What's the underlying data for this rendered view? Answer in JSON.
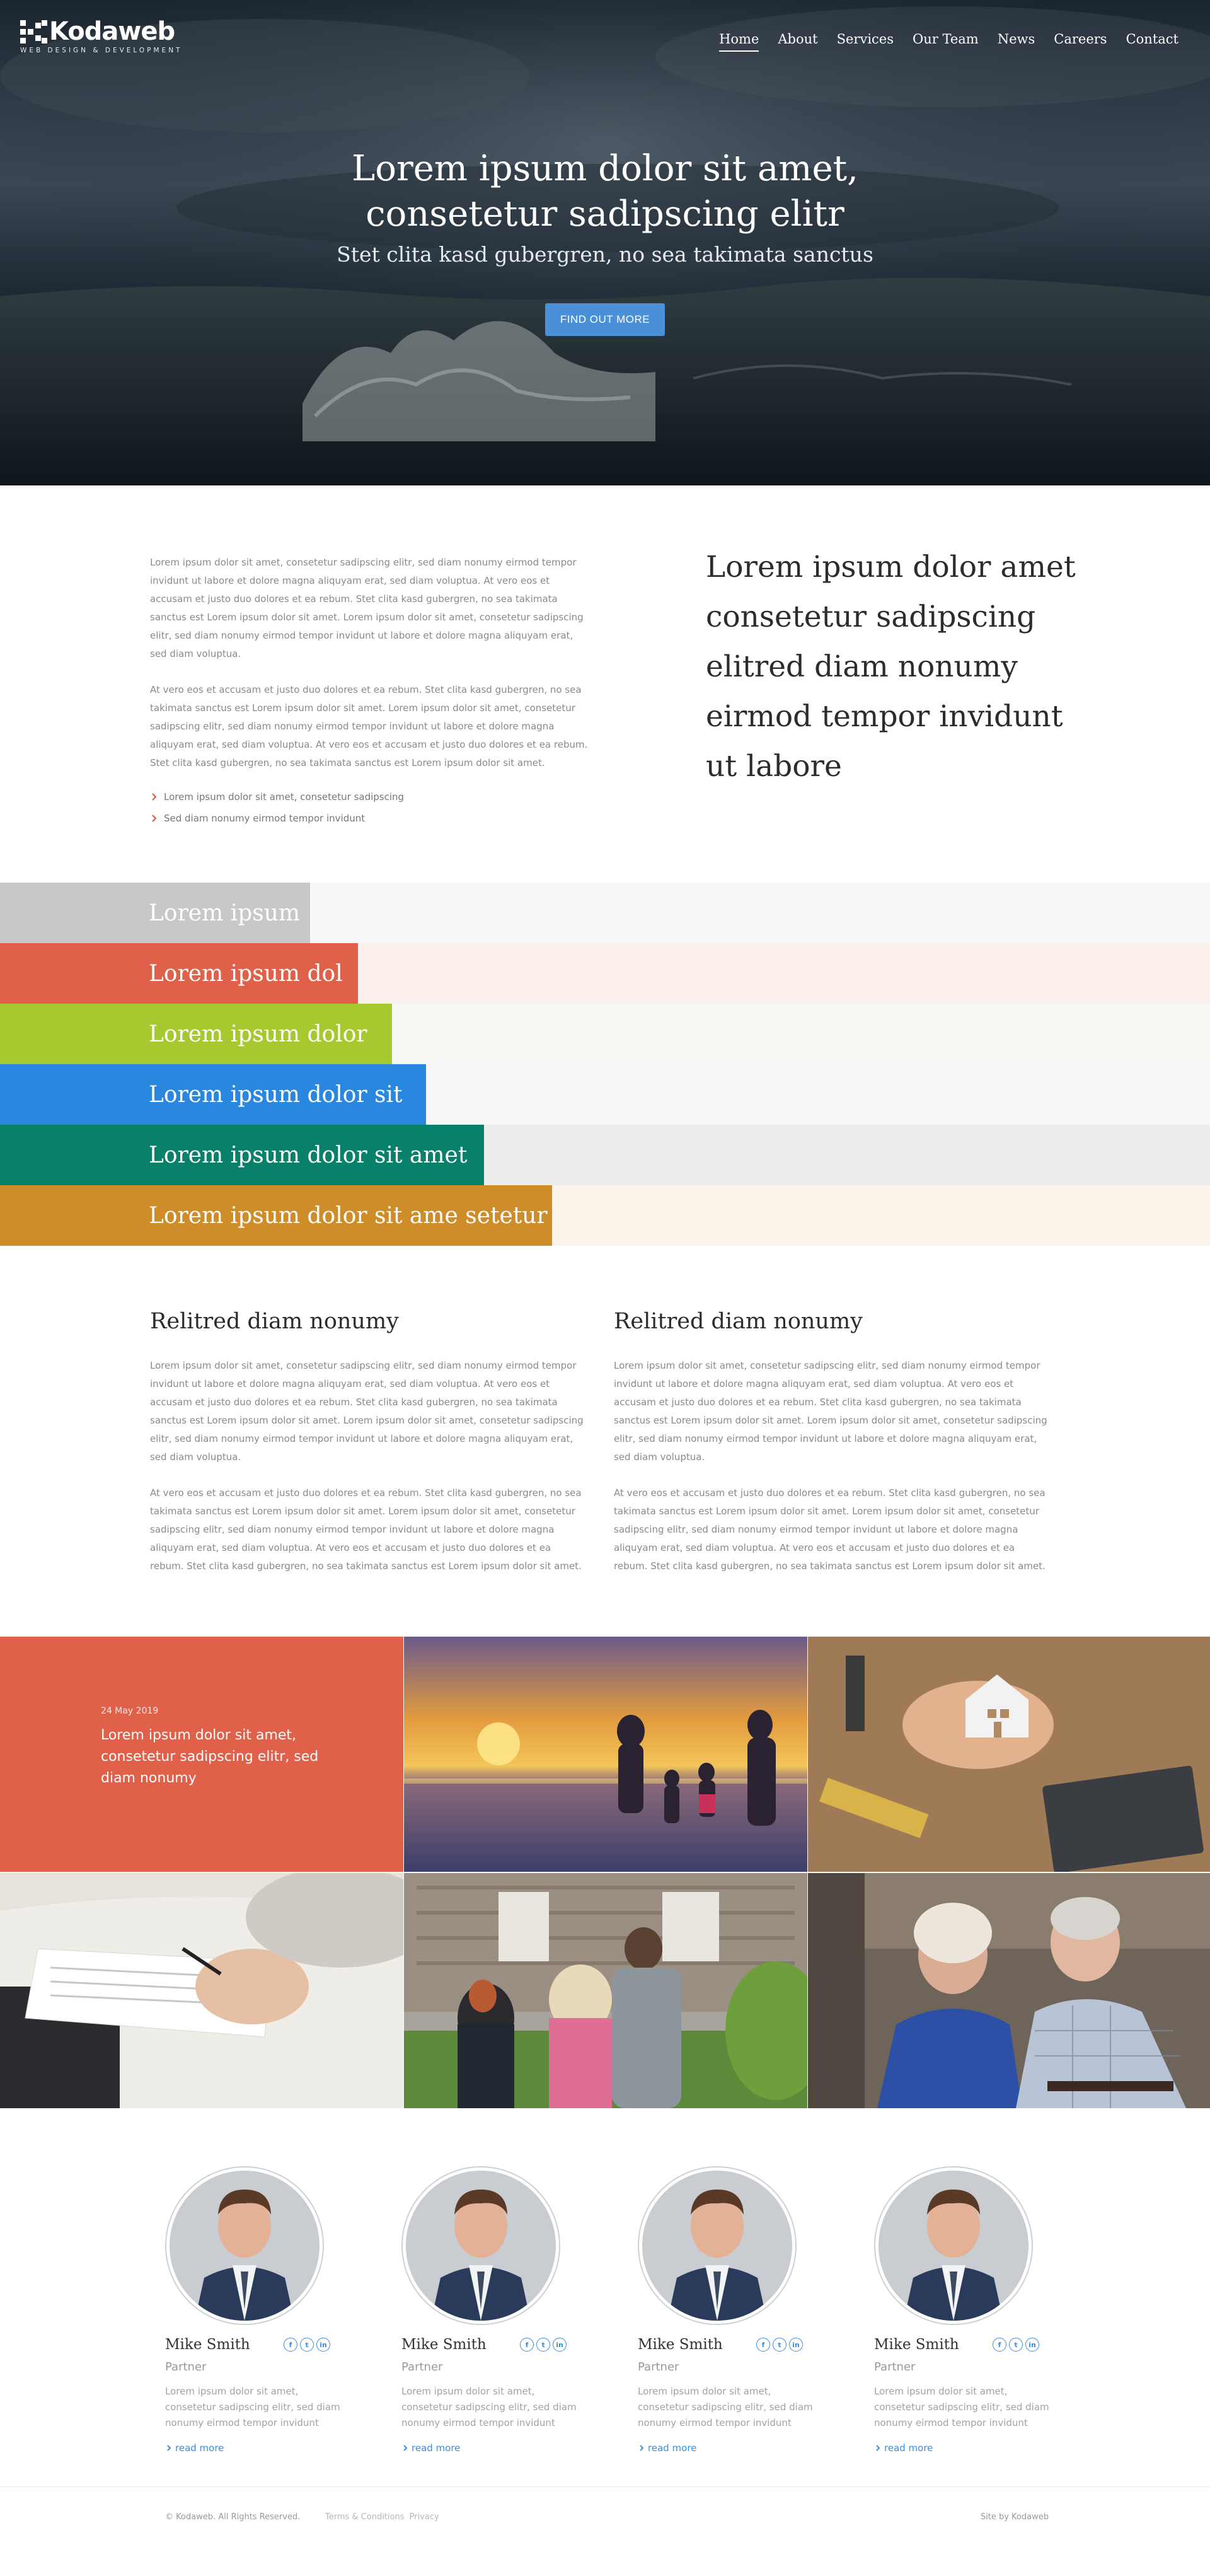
{
  "brand": {
    "name": "Kodaweb",
    "tagline": "WEB DESIGN & DEVELOPMENT"
  },
  "nav": {
    "items": [
      "Home",
      "About",
      "Services",
      "Our Team",
      "News",
      "Careers",
      "Contact"
    ],
    "active": "Home"
  },
  "hero": {
    "title_line1": "Lorem ipsum dolor sit amet,",
    "title_line2": "consetetur sadipscing elitr",
    "subtitle": "Stet clita kasd gubergren, no sea takimata sanctus",
    "cta": "FIND OUT MORE"
  },
  "intro": {
    "paragraph1": "Lorem ipsum dolor sit amet, consetetur sadipscing elitr, sed diam nonumy eirmod tempor invidunt ut labore et dolore magna aliquyam erat, sed diam voluptua. At vero eos et accusam et justo duo dolores et ea rebum. Stet clita kasd gubergren, no sea takimata sanctus est Lorem ipsum dolor sit amet. Lorem ipsum dolor sit amet, consetetur sadipscing elitr, sed diam nonumy eirmod tempor invidunt ut labore et dolore magna aliquyam erat, sed diam voluptua.",
    "paragraph2": "At vero eos et accusam et justo duo dolores et ea rebum. Stet clita kasd gubergren, no sea takimata sanctus est Lorem ipsum dolor sit amet. Lorem ipsum dolor sit amet, consetetur sadipscing elitr, sed diam nonumy eirmod tempor invidunt ut labore et dolore magna aliquyam erat, sed diam voluptua. At vero eos et accusam et justo duo dolores et ea rebum. Stet clita kasd gubergren, no sea takimata sanctus est Lorem ipsum dolor sit amet.",
    "bullets": [
      "Lorem ipsum dolor sit amet, consetetur sadipscing",
      "Sed diam nonumy eirmod tempor invidunt"
    ],
    "quote": "Lorem ipsum dolor amet consetetur sadipscing elitred diam nonumy eirmod tempor invidunt ut labore"
  },
  "bars": [
    {
      "label": "Lorem ipsum",
      "color": "#c8c8c8",
      "track": "#f8f8f8"
    },
    {
      "label": "Lorem ipsum dol",
      "color": "#e0604a",
      "track": "#fbefec"
    },
    {
      "label": "Lorem ipsum dolor",
      "color": "#a7c930",
      "track": "#f7f7f4"
    },
    {
      "label": "Lorem ipsum dolor sit",
      "color": "#2a87e0",
      "track": "#f7f7f7"
    },
    {
      "label": "Lorem ipsum dolor sit amet",
      "color": "#098069",
      "track": "#ececec"
    },
    {
      "label": "Lorem ipsum dolor sit ame setetur",
      "color": "#cf8d2a",
      "track": "#fbf3ea"
    }
  ],
  "columns": [
    {
      "heading": "Relitred diam nonumy",
      "paragraph1": "Lorem ipsum dolor sit amet, consetetur sadipscing elitr, sed diam nonumy eirmod tempor invidunt ut labore et dolore magna aliquyam erat, sed diam voluptua. At vero eos et accusam et justo duo dolores et ea rebum. Stet clita kasd gubergren, no sea takimata sanctus est Lorem ipsum dolor sit amet. Lorem ipsum dolor sit amet, consetetur sadipscing elitr, sed diam nonumy eirmod tempor invidunt ut labore et dolore magna aliquyam erat, sed diam voluptua.",
      "paragraph2": "At vero eos et accusam et justo duo dolores et ea rebum. Stet clita kasd gubergren, no sea takimata sanctus est Lorem ipsum dolor sit amet. Lorem ipsum dolor sit amet, consetetur sadipscing elitr, sed diam nonumy eirmod tempor invidunt ut labore et dolore magna aliquyam erat, sed diam voluptua. At vero eos et accusam et justo duo dolores et ea rebum. Stet clita kasd gubergren, no sea takimata sanctus est Lorem ipsum dolor sit amet."
    },
    {
      "heading": "Relitred diam nonumy",
      "paragraph1": "Lorem ipsum dolor sit amet, consetetur sadipscing elitr, sed diam nonumy eirmod tempor invidunt ut labore et dolore magna aliquyam erat, sed diam voluptua. At vero eos et accusam et justo duo dolores et ea rebum. Stet clita kasd gubergren, no sea takimata sanctus est Lorem ipsum dolor sit amet. Lorem ipsum dolor sit amet, consetetur sadipscing elitr, sed diam nonumy eirmod tempor invidunt ut labore et dolore magna aliquyam erat, sed diam voluptua.",
      "paragraph2": "At vero eos et accusam et justo duo dolores et ea rebum. Stet clita kasd gubergren, no sea takimata sanctus est Lorem ipsum dolor sit amet. Lorem ipsum dolor sit amet, consetetur sadipscing elitr, sed diam nonumy eirmod tempor invidunt ut labore et dolore magna aliquyam erat, sed diam voluptua. At vero eos et accusam et justo duo dolores et ea rebum. Stet clita kasd gubergren, no sea takimata sanctus est Lorem ipsum dolor sit amet."
    }
  ],
  "news": {
    "date": "24 May 2019",
    "title": "Lorem ipsum dolor sit amet, consetetur sadipscing elitr, sed diam nonumy"
  },
  "team": [
    {
      "name": "Mike Smith",
      "role": "Partner",
      "bio": "Lorem ipsum dolor sit amet, consetetur sadipscing elitr, sed diam nonumy eirmod tempor invidunt",
      "more": "read more"
    },
    {
      "name": "Mike Smith",
      "role": "Partner",
      "bio": "Lorem ipsum dolor sit amet, consetetur sadipscing elitr, sed diam nonumy eirmod tempor invidunt",
      "more": "read more"
    },
    {
      "name": "Mike Smith",
      "role": "Partner",
      "bio": "Lorem ipsum dolor sit amet, consetetur sadipscing elitr, sed diam nonumy eirmod tempor invidunt",
      "more": "read more"
    },
    {
      "name": "Mike Smith",
      "role": "Partner",
      "bio": "Lorem ipsum dolor sit amet, consetetur sadipscing elitr, sed diam nonumy eirmod tempor invidunt",
      "more": "read more"
    }
  ],
  "social_icons": [
    "facebook-icon",
    "twitter-icon",
    "linkedin-icon"
  ],
  "footer": {
    "copyright": "© Kodaweb. All Rights Reserved.",
    "terms": "Terms & Conditions",
    "privacy": "Privacy",
    "credit": "Site by Kodaweb"
  },
  "colors": {
    "accent": "#4a90d9",
    "orange": "#e0604a",
    "link": "#3b8ee0"
  }
}
